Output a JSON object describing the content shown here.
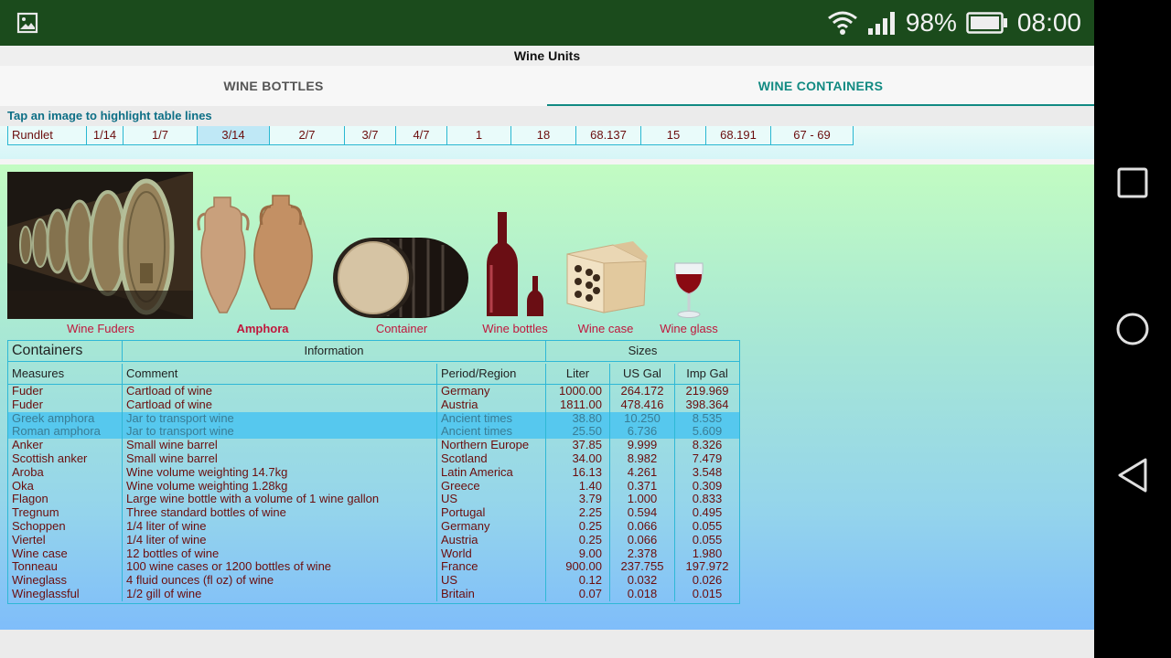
{
  "status_bar": {
    "battery": "98%",
    "time": "08:00"
  },
  "app": {
    "title": "Wine Units"
  },
  "tabs": [
    {
      "label": "WINE BOTTLES",
      "active": false
    },
    {
      "label": "WINE CONTAINERS",
      "active": true
    }
  ],
  "hint": "Tap an image to highlight table lines",
  "rundlet_row": [
    "Rundlet",
    "1/14",
    "1/7",
    "3/14",
    "2/7",
    "3/7",
    "4/7",
    "1",
    "18",
    "68.137",
    "15",
    "68.191",
    "67 - 69"
  ],
  "images": [
    {
      "label": "Wine Fuders",
      "selected": false
    },
    {
      "label": "Amphora",
      "selected": true
    },
    {
      "label": "Container",
      "selected": false
    },
    {
      "label": "Wine bottles",
      "selected": false
    },
    {
      "label": "Wine case",
      "selected": false
    },
    {
      "label": "Wine glass",
      "selected": false
    }
  ],
  "table": {
    "group_headers": {
      "containers": "Containers",
      "information": "Information",
      "sizes": "Sizes"
    },
    "columns": {
      "measures": "Measures",
      "comment": "Comment",
      "period": "Period/Region",
      "liter": "Liter",
      "usgal": "US Gal",
      "impgal": "Imp Gal"
    },
    "rows": [
      {
        "measure": "Fuder",
        "comment": "Cartload of wine",
        "period": "Germany",
        "liter": "1000.00",
        "usgal": "264.172",
        "impgal": "219.969",
        "highlight": false
      },
      {
        "measure": "Fuder",
        "comment": "Cartload of wine",
        "period": "Austria",
        "liter": "1811.00",
        "usgal": "478.416",
        "impgal": "398.364",
        "highlight": false
      },
      {
        "measure": "Greek amphora",
        "comment": "Jar to transport wine",
        "period": "Ancient times",
        "liter": "38.80",
        "usgal": "10.250",
        "impgal": "8.535",
        "highlight": true
      },
      {
        "measure": "Roman amphora",
        "comment": "Jar to transport wine",
        "period": "Ancient times",
        "liter": "25.50",
        "usgal": "6.736",
        "impgal": "5.609",
        "highlight": true
      },
      {
        "measure": "Anker",
        "comment": "Small wine barrel",
        "period": "Northern Europe",
        "liter": "37.85",
        "usgal": "9.999",
        "impgal": "8.326",
        "highlight": false
      },
      {
        "measure": "Scottish anker",
        "comment": "Small wine barrel",
        "period": "Scotland",
        "liter": "34.00",
        "usgal": "8.982",
        "impgal": "7.479",
        "highlight": false
      },
      {
        "measure": "Aroba",
        "comment": "Wine volume weighting 14.7kg",
        "period": "Latin America",
        "liter": "16.13",
        "usgal": "4.261",
        "impgal": "3.548",
        "highlight": false
      },
      {
        "measure": "Oka",
        "comment": "Wine volume weighting 1.28kg",
        "period": "Greece",
        "liter": "1.40",
        "usgal": "0.371",
        "impgal": "0.309",
        "highlight": false
      },
      {
        "measure": "Flagon",
        "comment": "Large wine bottle with a volume of 1 wine gallon",
        "period": "US",
        "liter": "3.79",
        "usgal": "1.000",
        "impgal": "0.833",
        "highlight": false
      },
      {
        "measure": "Tregnum",
        "comment": "Three standard bottles of wine",
        "period": "Portugal",
        "liter": "2.25",
        "usgal": "0.594",
        "impgal": "0.495",
        "highlight": false
      },
      {
        "measure": "Schoppen",
        "comment": "1/4 liter of wine",
        "period": "Germany",
        "liter": "0.25",
        "usgal": "0.066",
        "impgal": "0.055",
        "highlight": false
      },
      {
        "measure": "Viertel",
        "comment": "1/4 liter of wine",
        "period": "Austria",
        "liter": "0.25",
        "usgal": "0.066",
        "impgal": "0.055",
        "highlight": false
      },
      {
        "measure": "Wine case",
        "comment": "12 bottles of wine",
        "period": "World",
        "liter": "9.00",
        "usgal": "2.378",
        "impgal": "1.980",
        "highlight": false
      },
      {
        "measure": "Tonneau",
        "comment": "100 wine cases or 1200 bottles of wine",
        "period": "France",
        "liter": "900.00",
        "usgal": "237.755",
        "impgal": "197.972",
        "highlight": false
      },
      {
        "measure": "Wineglass",
        "comment": "4 fluid ounces (fl oz) of wine",
        "period": "US",
        "liter": "0.12",
        "usgal": "0.032",
        "impgal": "0.026",
        "highlight": false
      },
      {
        "measure": "Wineglassful",
        "comment": "1/2 gill of wine",
        "period": "Britain",
        "liter": "0.07",
        "usgal": "0.018",
        "impgal": "0.015",
        "highlight": false
      }
    ]
  },
  "colors": {
    "status_bar": "#1b4b1c",
    "accent": "#118a82",
    "label_red": "#c0173c",
    "cell_text": "#6b0d0d",
    "highlight_row": "#56c8ee"
  }
}
